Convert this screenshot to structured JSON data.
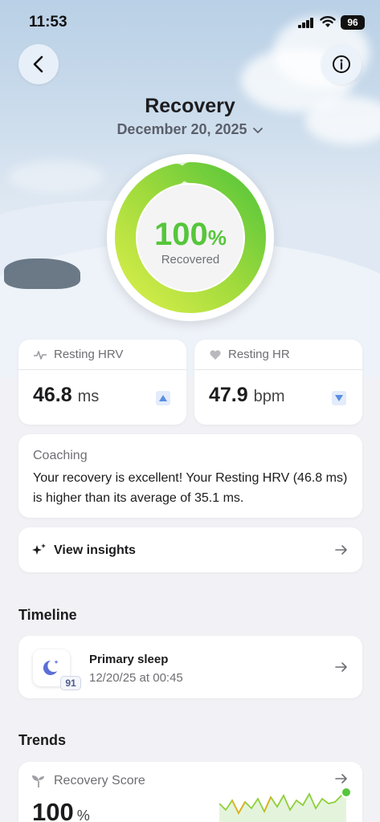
{
  "status_bar": {
    "time": "11:53",
    "battery": "96"
  },
  "header": {
    "title": "Recovery",
    "date": "December 20, 2025"
  },
  "recovery_ring": {
    "value": "100",
    "unit": "%",
    "label": "Recovered",
    "fraction": 1.0
  },
  "metrics": [
    {
      "label": "Resting HRV",
      "value": "46.8",
      "unit": "ms",
      "trend": "up"
    },
    {
      "label": "Resting HR",
      "value": "47.9",
      "unit": "bpm",
      "trend": "down"
    }
  ],
  "coaching": {
    "label": "Coaching",
    "text": "Your recovery is excellent! Your Resting HRV (46.8 ms) is higher than its average of 35.1 ms."
  },
  "insights": {
    "label": "View insights"
  },
  "timeline": {
    "title": "Timeline",
    "items": [
      {
        "title": "Primary sleep",
        "subtitle": "12/20/25 at 00:45",
        "score": "91"
      }
    ]
  },
  "trends": {
    "title": "Trends",
    "recovery_score": {
      "label": "Recovery Score",
      "value": "100",
      "unit": "%"
    }
  },
  "colors": {
    "accent_green": "#56c63b",
    "ring_light": "#d8ee4a",
    "trend_blue": "#5a8fe0"
  }
}
